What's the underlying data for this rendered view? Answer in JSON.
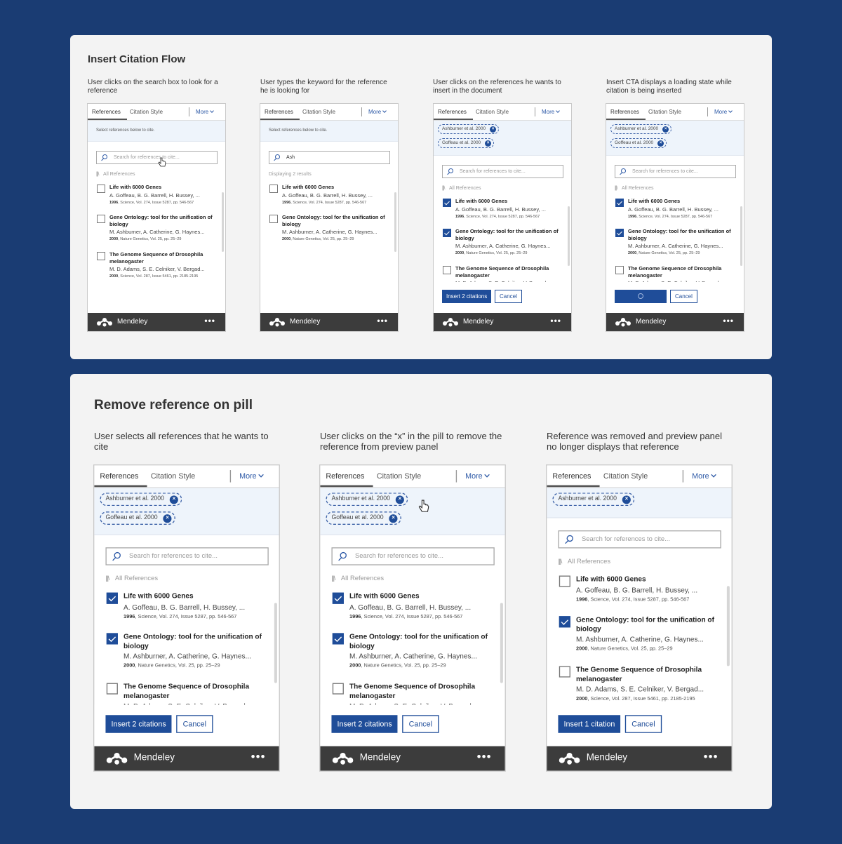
{
  "common": {
    "tab_references": "References",
    "tab_citation_style": "Citation Style",
    "tab_more": "More",
    "search_placeholder": "Search for references to cite...",
    "all_references": "All References",
    "cancel": "Cancel",
    "footer_name": "Mendeley",
    "footer_menu": "•••",
    "pill_remove_glyph": "×",
    "library_glyph": "|||\\",
    "info_select": "Select references below to cite."
  },
  "references": [
    {
      "title": "Life with 6000 Genes",
      "authors": "A. Goffeau, B. G. Barrell, H. Bussey, ...",
      "year": "1996",
      "meta": ", Science, Vol. 274, Issue 5287, pp. 546-567"
    },
    {
      "title": "Gene Ontology: tool for the unification of biology",
      "authors": "M. Ashburner, A. Catherine, G. Haynes...",
      "year": "2000",
      "meta": ", Nature Genetics, Vol. 25, pp. 25–29"
    },
    {
      "title": "The Genome Sequence of Drosophila melanogaster",
      "authors": "M. D. Adams, S. E. Celniker, V. Bergad...",
      "year": "2000",
      "meta": ", Science, Vol. 287, Issue 5461, pp. 2185-2195"
    }
  ],
  "pills": [
    "Ashburner et al. 2000",
    "Goffeau et al. 2000"
  ],
  "top": {
    "title": "Insert Citation Flow",
    "steps": [
      {
        "desc": "User clicks on the search box to look for a reference"
      },
      {
        "desc": "User types the keyword for the reference he is looking for",
        "search_value": "Ash",
        "results_label": "Displaying 2 results"
      },
      {
        "desc": "User clicks on the references he wants to insert in the document",
        "insert_label": "Insert 2 citations"
      },
      {
        "desc": "Insert CTA displays a loading state while citation is being inserted"
      }
    ]
  },
  "bottom": {
    "title": "Remove reference on pill",
    "steps": [
      {
        "desc": "User selects all references that he wants to cite",
        "insert_label": "Insert 2 citations"
      },
      {
        "desc": "User clicks on the “x” in the pill to remove the reference from preview panel",
        "insert_label": "Insert 2 citations"
      },
      {
        "desc": "Reference was removed and preview panel no longer displays that reference",
        "insert_label": "Insert 1 citation"
      }
    ]
  },
  "colors": {
    "page_bg": "#1a3c73",
    "card_bg": "#f3f3f3",
    "primary": "#1f4d99",
    "footer_bg": "#3c3c3c",
    "info_bg": "#eef4fb"
  }
}
